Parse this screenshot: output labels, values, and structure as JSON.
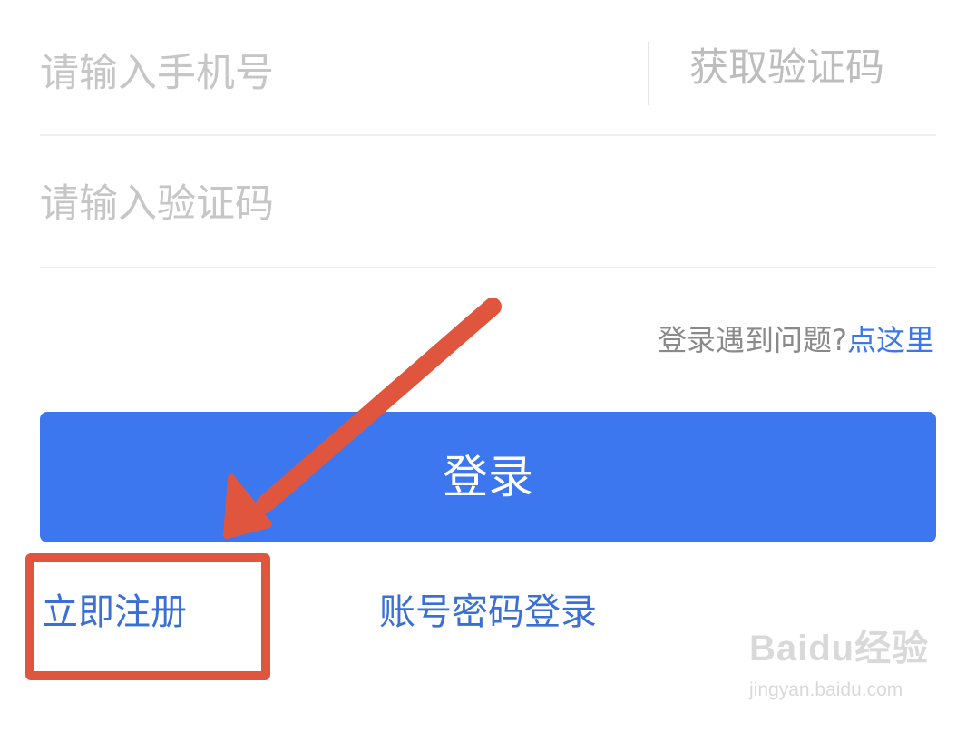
{
  "form": {
    "phone_placeholder": "请输入手机号",
    "get_code_label": "获取验证码",
    "code_placeholder": "请输入验证码"
  },
  "help": {
    "text": "登录遇到问题?",
    "link": "点这里"
  },
  "login_button_label": "登录",
  "footer": {
    "register_label": "立即注册",
    "password_login_label": "账号密码登录"
  },
  "annotation": {
    "color": "#e0553e",
    "arrow_icon": "arrow-icon"
  },
  "colors": {
    "primary": "#3c77f0",
    "link": "#3a6fd6",
    "placeholder": "#c6c6c6"
  },
  "watermark": {
    "brand": "Baidu经验",
    "url": "jingyan.baidu.com"
  }
}
